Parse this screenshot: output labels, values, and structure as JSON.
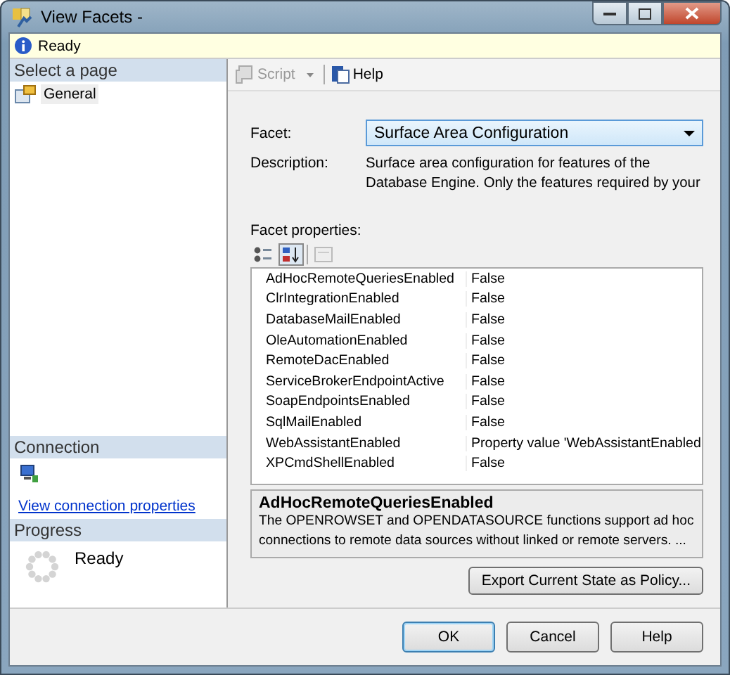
{
  "window": {
    "title": "View Facets -"
  },
  "info_bar": {
    "text": "Ready"
  },
  "sidebar": {
    "header": "Select a page",
    "items": [
      {
        "label": "General",
        "selected": true
      }
    ],
    "connection": {
      "header": "Connection",
      "link": "View connection properties"
    },
    "progress": {
      "header": "Progress",
      "status": "Ready"
    }
  },
  "toolbar": {
    "items": [
      {
        "label": "Script",
        "disabled": true,
        "dropdown": true
      },
      {
        "label": "Help",
        "disabled": false,
        "dropdown": false
      }
    ]
  },
  "facet": {
    "label": "Facet:",
    "value": "Surface Area Configuration"
  },
  "description": {
    "label": "Description:",
    "text": "Surface area configuration for features of the Database Engine. Only the features required by your"
  },
  "properties": {
    "label": "Facet properties:",
    "sort_buttons": [
      {
        "kind": "categorized",
        "selected": false
      },
      {
        "kind": "alphabetical",
        "selected": true
      },
      {
        "kind": "pages",
        "selected": false
      }
    ],
    "rows": [
      {
        "name": "AdHocRemoteQueriesEnabled",
        "value": "False"
      },
      {
        "name": "ClrIntegrationEnabled",
        "value": "False"
      },
      {
        "name": "DatabaseMailEnabled",
        "value": "False"
      },
      {
        "name": "OleAutomationEnabled",
        "value": "False"
      },
      {
        "name": "RemoteDacEnabled",
        "value": "False"
      },
      {
        "name": "ServiceBrokerEndpointActive",
        "value": "False"
      },
      {
        "name": "SoapEndpointsEnabled",
        "value": "False"
      },
      {
        "name": "SqlMailEnabled",
        "value": "False"
      },
      {
        "name": "WebAssistantEnabled",
        "value": "Property value 'WebAssistantEnabled"
      },
      {
        "name": "XPCmdShellEnabled",
        "value": "False"
      }
    ],
    "help_title": "AdHocRemoteQueriesEnabled",
    "help_text": "The OPENROWSET and OPENDATASOURCE functions support ad hoc connections to remote data sources without linked or remote servers. ..."
  },
  "export_button": "Export Current State as Policy...",
  "buttons": [
    "OK",
    "Cancel",
    "Help"
  ]
}
